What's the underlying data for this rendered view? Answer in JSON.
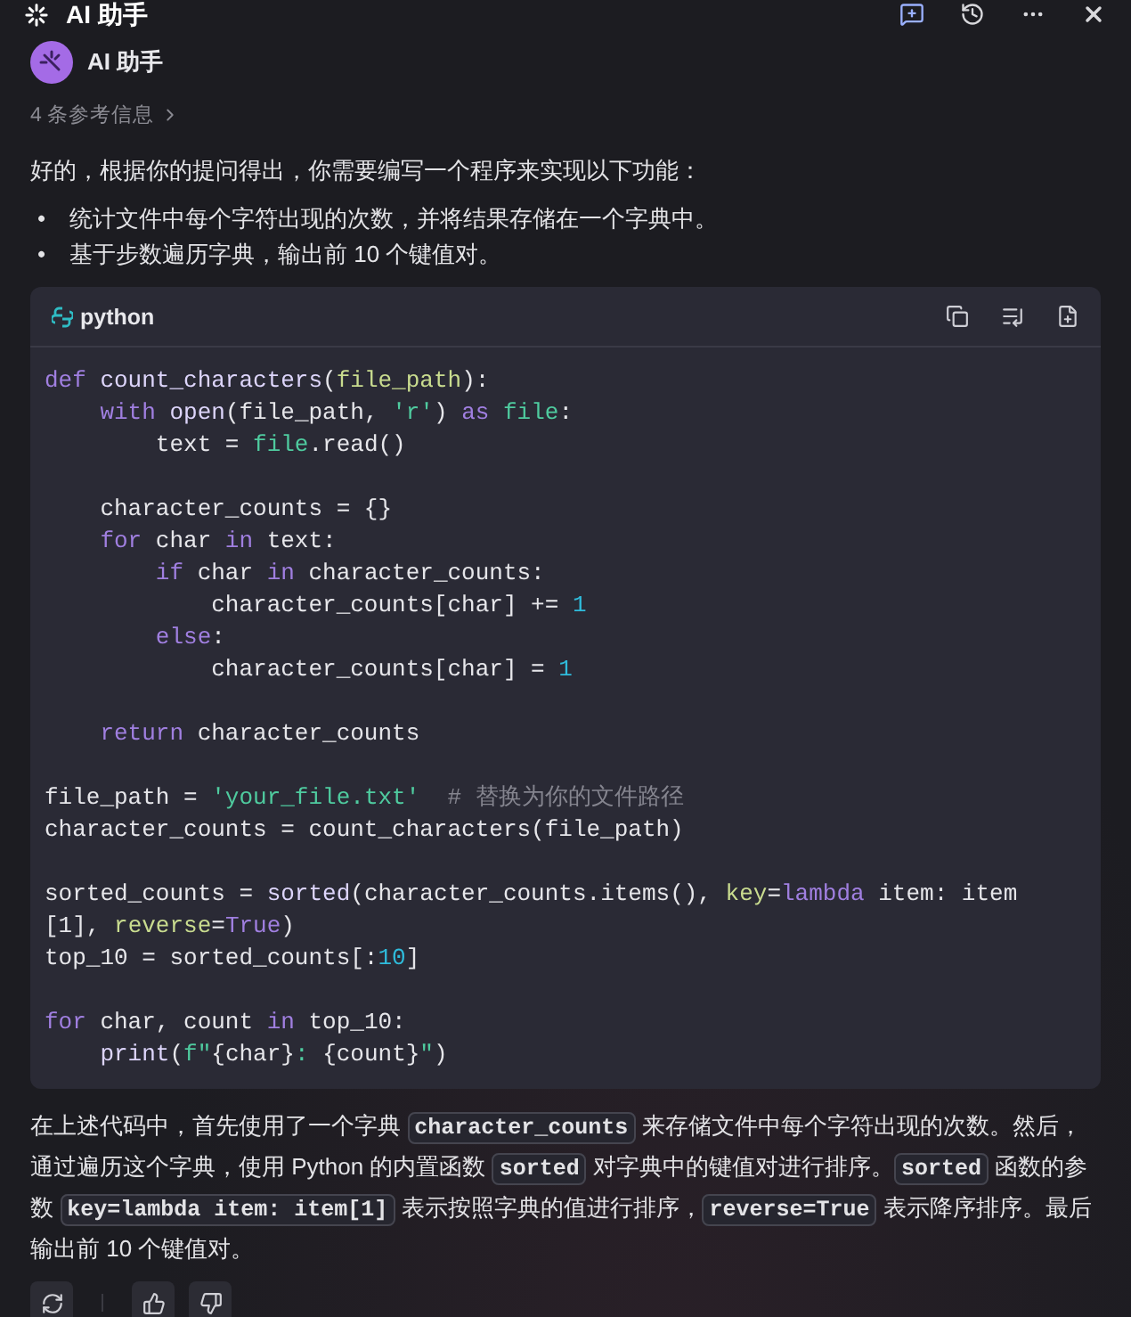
{
  "header": {
    "title": "AI 助手"
  },
  "message": {
    "author": "AI 助手",
    "references": "4 条参考信息",
    "intro": "好的，根据你的提问得出，你需要编写一个程序来实现以下功能：",
    "bullets": [
      {
        "marker": "•",
        "text": "统计文件中每个字符出现的次数，并将结果存储在一个字典中。"
      },
      {
        "marker": "•",
        "text": "基于步数遍历字典，输出前 10 个键值对。"
      }
    ],
    "code_block": {
      "language": "python",
      "lines": [
        {
          "gap_before": false,
          "tokens": [
            {
              "kind": "keyword",
              "text": "def"
            },
            {
              "kind": "function",
              "text": " count_characters"
            },
            {
              "kind": "plain",
              "text": "("
            },
            {
              "kind": "param",
              "text": "file_path"
            },
            {
              "kind": "plain",
              "text": "):"
            }
          ]
        },
        {
          "gap_before": false,
          "tokens": [
            {
              "kind": "keyword",
              "text": "    with"
            },
            {
              "kind": "function",
              "text": " open"
            },
            {
              "kind": "plain",
              "text": "(file_path, "
            },
            {
              "kind": "string",
              "text": "'r'"
            },
            {
              "kind": "plain",
              "text": ") "
            },
            {
              "kind": "keyword",
              "text": "as"
            },
            {
              "kind": "builtin",
              "text": " file"
            },
            {
              "kind": "plain",
              "text": ":"
            }
          ]
        },
        {
          "gap_before": false,
          "tokens": [
            {
              "kind": "plain",
              "text": "        text = "
            },
            {
              "kind": "builtin",
              "text": "file"
            },
            {
              "kind": "plain",
              "text": ".read()"
            }
          ]
        },
        {
          "gap_before": true,
          "tokens": [
            {
              "kind": "plain",
              "text": "    character_counts = {}"
            }
          ]
        },
        {
          "gap_before": false,
          "tokens": [
            {
              "kind": "keyword",
              "text": "    for"
            },
            {
              "kind": "plain",
              "text": " char "
            },
            {
              "kind": "keyword",
              "text": "in"
            },
            {
              "kind": "plain",
              "text": " text:"
            }
          ]
        },
        {
          "gap_before": false,
          "tokens": [
            {
              "kind": "keyword",
              "text": "        if"
            },
            {
              "kind": "plain",
              "text": " char "
            },
            {
              "kind": "keyword",
              "text": "in"
            },
            {
              "kind": "plain",
              "text": " character_counts:"
            }
          ]
        },
        {
          "gap_before": false,
          "tokens": [
            {
              "kind": "plain",
              "text": "            character_counts[char] += "
            },
            {
              "kind": "number",
              "text": "1"
            }
          ]
        },
        {
          "gap_before": false,
          "tokens": [
            {
              "kind": "keyword",
              "text": "        else"
            },
            {
              "kind": "plain",
              "text": ":"
            }
          ]
        },
        {
          "gap_before": false,
          "tokens": [
            {
              "kind": "plain",
              "text": "            character_counts[char] = "
            },
            {
              "kind": "number",
              "text": "1"
            }
          ]
        },
        {
          "gap_before": true,
          "tokens": [
            {
              "kind": "keyword",
              "text": "    return"
            },
            {
              "kind": "plain",
              "text": " character_counts"
            }
          ]
        },
        {
          "gap_before": true,
          "tokens": [
            {
              "kind": "plain",
              "text": "file_path = "
            },
            {
              "kind": "string",
              "text": "'your_file.txt'"
            },
            {
              "kind": "comment",
              "text": "  # 替换为你的文件路径"
            }
          ]
        },
        {
          "gap_before": false,
          "tokens": [
            {
              "kind": "plain",
              "text": "character_counts = count_characters(file_path)"
            }
          ]
        },
        {
          "gap_before": true,
          "tokens": [
            {
              "kind": "plain",
              "text": "sorted_counts = "
            },
            {
              "kind": "function",
              "text": "sorted"
            },
            {
              "kind": "plain",
              "text": "(character_counts.items(), "
            },
            {
              "kind": "param",
              "text": "key"
            },
            {
              "kind": "plain",
              "text": "="
            },
            {
              "kind": "keyword",
              "text": "lambda"
            },
            {
              "kind": "plain",
              "text": " item: item"
            }
          ]
        },
        {
          "gap_before": false,
          "tokens": [
            {
              "kind": "plain",
              "text": "[1], "
            },
            {
              "kind": "param",
              "text": "reverse"
            },
            {
              "kind": "plain",
              "text": "="
            },
            {
              "kind": "keyword",
              "text": "True"
            },
            {
              "kind": "plain",
              "text": ")"
            }
          ]
        },
        {
          "gap_before": false,
          "tokens": [
            {
              "kind": "plain",
              "text": "top_10 = sorted_counts[:"
            },
            {
              "kind": "number",
              "text": "10"
            },
            {
              "kind": "plain",
              "text": "]"
            }
          ]
        },
        {
          "gap_before": true,
          "tokens": [
            {
              "kind": "keyword",
              "text": "for"
            },
            {
              "kind": "plain",
              "text": " char, count "
            },
            {
              "kind": "keyword",
              "text": "in"
            },
            {
              "kind": "plain",
              "text": " top_10:"
            }
          ]
        },
        {
          "gap_before": false,
          "tokens": [
            {
              "kind": "function",
              "text": "    print"
            },
            {
              "kind": "plain",
              "text": "("
            },
            {
              "kind": "string",
              "text": "f\""
            },
            {
              "kind": "plain",
              "text": "{char}"
            },
            {
              "kind": "string",
              "text": ": "
            },
            {
              "kind": "plain",
              "text": "{count}"
            },
            {
              "kind": "string",
              "text": "\""
            },
            {
              "kind": "plain",
              "text": ")"
            }
          ]
        }
      ]
    },
    "explanation": [
      {
        "kind": "text",
        "text": "在上述代码中，首先使用了一个字典 "
      },
      {
        "kind": "code",
        "text": "character_counts"
      },
      {
        "kind": "text",
        "text": " 来存储文件中每个字符出现的次数。然后，通过遍历这个字典，使用 Python 的内置函数 "
      },
      {
        "kind": "code",
        "text": "sorted"
      },
      {
        "kind": "text",
        "text": " 对字典中的键值对进行排序。"
      },
      {
        "kind": "code",
        "text": "sorted"
      },
      {
        "kind": "text",
        "text": " 函数的参数 "
      },
      {
        "kind": "code",
        "text": "key=lambda item: item[1]"
      },
      {
        "kind": "text",
        "text": " 表示按照字典的值进行排序，"
      },
      {
        "kind": "code",
        "text": "reverse=True"
      },
      {
        "kind": "text",
        "text": " 表示降序排序。最后输出前 10 个键值对。"
      }
    ]
  }
}
